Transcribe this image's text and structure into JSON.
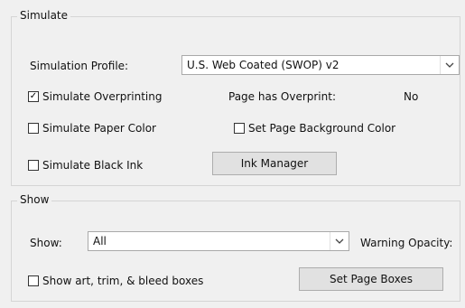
{
  "simulate": {
    "title": "Simulate",
    "simulation_profile_label": "Simulation Profile:",
    "simulation_profile_value": "U.S. Web Coated (SWOP) v2",
    "simulate_overprinting": {
      "label": "Simulate Overprinting",
      "checked": true,
      "mark": "✓"
    },
    "page_has_overprint_label": "Page has Overprint:",
    "page_has_overprint_value": "No",
    "simulate_paper_color": {
      "label": "Simulate Paper Color",
      "checked": false
    },
    "set_page_background_color": {
      "label": "Set Page Background Color",
      "checked": false
    },
    "simulate_black_ink": {
      "label": "Simulate Black Ink",
      "checked": false
    },
    "ink_manager_label": "Ink Manager"
  },
  "show": {
    "title": "Show",
    "show_label": "Show:",
    "show_value": "All",
    "warning_opacity_label": "Warning Opacity:",
    "show_art_trim_bleed": {
      "label": "Show art, trim, & bleed boxes",
      "checked": false
    },
    "set_page_boxes_label": "Set Page Boxes"
  },
  "icons": {
    "dropdown": "chevron-down-icon",
    "arrow_glyph": "⌄"
  }
}
